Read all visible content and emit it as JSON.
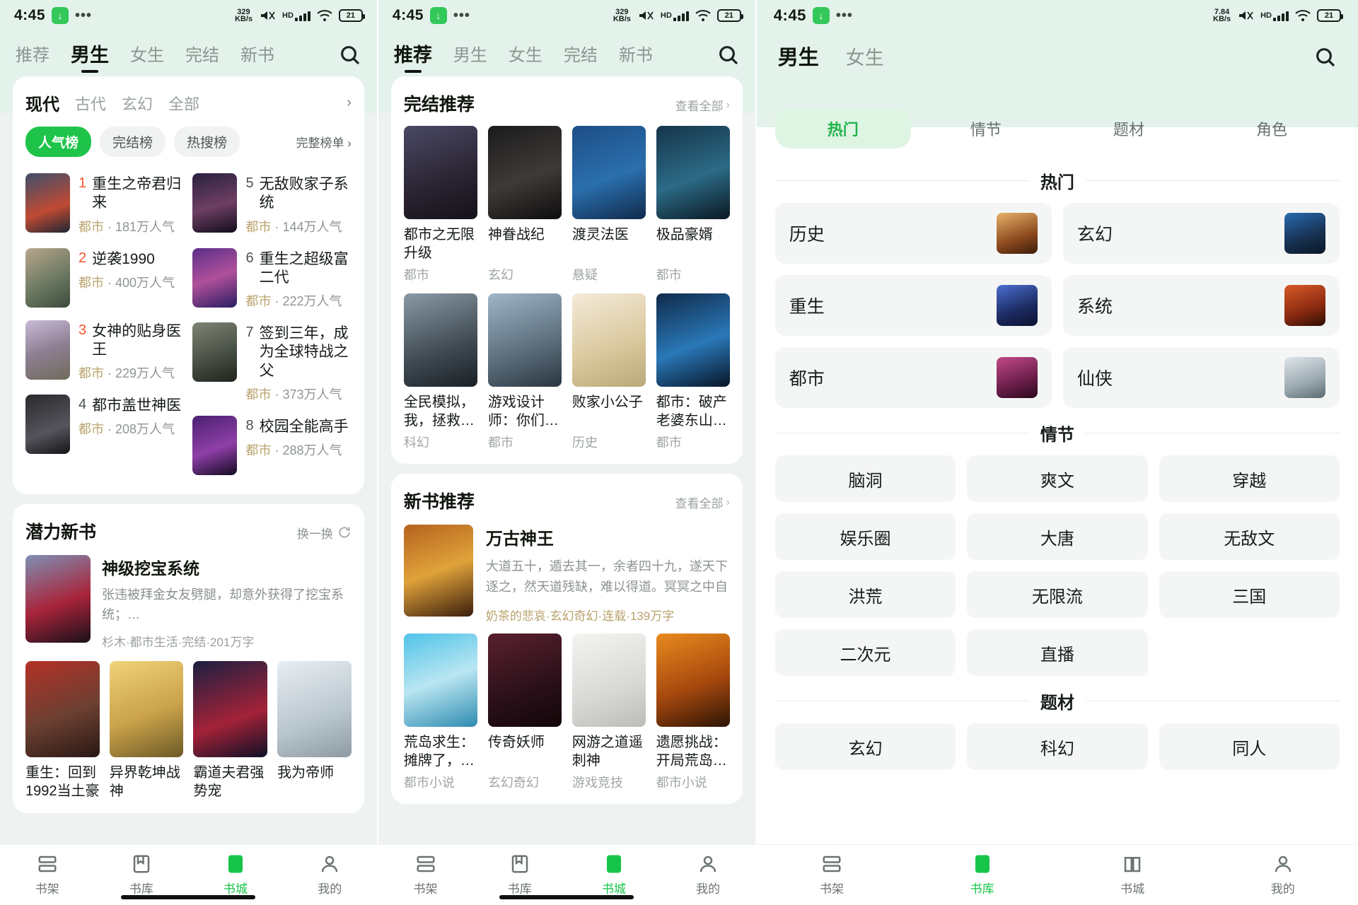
{
  "status_bar": {
    "time": "4:45",
    "download_icon": "download-icon",
    "more_dots": "•••",
    "net_speed_1": "329",
    "net_speed_unit": "KB/s",
    "net_speed_3": "7.84",
    "battery": "21",
    "hd_label": "HD"
  },
  "panel1": {
    "tabs": [
      {
        "label": "推荐",
        "active": false
      },
      {
        "label": "男生",
        "active": true
      },
      {
        "label": "女生",
        "active": false
      },
      {
        "label": "完结",
        "active": false
      },
      {
        "label": "新书",
        "active": false
      }
    ],
    "search_icon": "search-icon",
    "rank_card": {
      "segments": [
        {
          "label": "现代",
          "active": true
        },
        {
          "label": "古代",
          "active": false
        },
        {
          "label": "玄幻",
          "active": false
        },
        {
          "label": "全部",
          "active": false
        }
      ],
      "segment_arrow": "›",
      "pills": [
        {
          "label": "人气榜",
          "active": true
        },
        {
          "label": "完结榜",
          "active": false
        },
        {
          "label": "热搜榜",
          "active": false
        }
      ],
      "full_rank_label": "完整榜单 ›",
      "items_left": [
        {
          "rank": "1",
          "title": "重生之帝君归来",
          "genre": "都市",
          "meta": "181万人气"
        },
        {
          "rank": "2",
          "title": "逆袭1990",
          "genre": "都市",
          "meta": "400万人气"
        },
        {
          "rank": "3",
          "title": "女神的贴身医王",
          "genre": "都市",
          "meta": "229万人气"
        },
        {
          "rank": "4",
          "title": "都市盖世神医",
          "genre": "都市",
          "meta": "208万人气"
        }
      ],
      "items_right": [
        {
          "rank": "5",
          "title": "无敌败家子系统",
          "genre": "都市",
          "meta": "144万人气"
        },
        {
          "rank": "6",
          "title": "重生之超级富二代",
          "genre": "都市",
          "meta": "222万人气"
        },
        {
          "rank": "7",
          "title": "签到三年，成为全球特战之父",
          "genre": "都市",
          "meta": "373万人气"
        },
        {
          "rank": "8",
          "title": "校园全能高手",
          "genre": "都市",
          "meta": "288万人气"
        }
      ]
    },
    "potential_card": {
      "title": "潜力新书",
      "refresh_label": "换一换",
      "refresh_icon": "refresh-icon",
      "featured": {
        "title": "神级挖宝系统",
        "desc": "张违被拜金女友劈腿，却意外获得了挖宝系统；…",
        "meta": "杉木·都市生活·完结·201万字"
      },
      "books": [
        {
          "title": "重生：回到1992当土豪"
        },
        {
          "title": "异界乾坤战神"
        },
        {
          "title": "霸道夫君强势宠"
        },
        {
          "title": "我为帝师"
        }
      ]
    },
    "bottom_nav": [
      {
        "label": "书架",
        "icon": "bookshelf-icon",
        "active": false
      },
      {
        "label": "书库",
        "icon": "library-icon",
        "active": false
      },
      {
        "label": "书城",
        "icon": "bookstore-icon",
        "active": true
      },
      {
        "label": "我的",
        "icon": "profile-icon",
        "active": false
      }
    ]
  },
  "panel2": {
    "tabs": [
      {
        "label": "推荐",
        "active": true
      },
      {
        "label": "男生",
        "active": false
      },
      {
        "label": "女生",
        "active": false
      },
      {
        "label": "完结",
        "active": false
      },
      {
        "label": "新书",
        "active": false
      }
    ],
    "search_icon": "search-icon",
    "finished_card": {
      "title": "完结推荐",
      "more_label": "查看全部",
      "more_icon": "chevron-right-icon",
      "row1": [
        {
          "title": "都市之无限升级",
          "genre": "都市"
        },
        {
          "title": "神眷战纪",
          "genre": "玄幻"
        },
        {
          "title": "渡灵法医",
          "genre": "悬疑"
        },
        {
          "title": "极品豪婿",
          "genre": "都市"
        }
      ],
      "row2": [
        {
          "title": "全民模拟，我，拯救…",
          "genre": "科幻"
        },
        {
          "title": "游戏设计师：你们…",
          "genre": "都市"
        },
        {
          "title": "败家小公子",
          "genre": "历史"
        },
        {
          "title": "都市：破产老婆东山…",
          "genre": "都市"
        }
      ]
    },
    "newbook_card": {
      "title": "新书推荐",
      "more_label": "查看全部",
      "more_icon": "chevron-right-icon",
      "featured": {
        "title": "万古神王",
        "desc": "大道五十，遁去其一，余者四十九，遂天下逐之，然天道残缺，难以得道。冥冥之中自有…",
        "meta": "奶茶的悲哀·玄幻奇幻·连载·139万字"
      },
      "books": [
        {
          "title": "荒岛求生：摊牌了，…",
          "genre": "都市小说"
        },
        {
          "title": "传奇妖师",
          "genre": "玄幻奇幻"
        },
        {
          "title": "网游之道遥刺神",
          "genre": "游戏竞技"
        },
        {
          "title": "遗愿挑战：开局荒岛…",
          "genre": "都市小说"
        }
      ]
    },
    "bottom_nav": [
      {
        "label": "书架",
        "icon": "bookshelf-icon",
        "active": false
      },
      {
        "label": "书库",
        "icon": "library-icon",
        "active": false
      },
      {
        "label": "书城",
        "icon": "bookstore-icon",
        "active": true
      },
      {
        "label": "我的",
        "icon": "profile-icon",
        "active": false
      }
    ]
  },
  "panel3": {
    "tabs": [
      {
        "label": "男生",
        "active": true
      },
      {
        "label": "女生",
        "active": false
      }
    ],
    "search_icon": "search-icon",
    "chips": [
      {
        "label": "热门",
        "active": true
      },
      {
        "label": "情节",
        "active": false
      },
      {
        "label": "题材",
        "active": false
      },
      {
        "label": "角色",
        "active": false
      }
    ],
    "section_hot": {
      "title": "热门",
      "items": [
        {
          "label": "历史",
          "thumb": "cover-history"
        },
        {
          "label": "玄幻",
          "thumb": "cover-xuanhuan"
        },
        {
          "label": "重生",
          "thumb": "cover-rebirth"
        },
        {
          "label": "系统",
          "thumb": "cover-system"
        },
        {
          "label": "都市",
          "thumb": "cover-urban"
        },
        {
          "label": "仙侠",
          "thumb": "cover-xianxia"
        }
      ]
    },
    "section_plot": {
      "title": "情节",
      "items": [
        "脑洞",
        "爽文",
        "穿越",
        "娱乐圈",
        "大唐",
        "无敌文",
        "洪荒",
        "无限流",
        "三国",
        "二次元",
        "直播"
      ]
    },
    "section_theme": {
      "title": "题材",
      "items": [
        "玄幻",
        "科幻",
        "同人"
      ]
    },
    "bottom_nav": [
      {
        "label": "书架",
        "icon": "bookshelf-icon",
        "active": false
      },
      {
        "label": "书库",
        "icon": "library-icon",
        "active": true
      },
      {
        "label": "书城",
        "icon": "bookstore-icon",
        "active": false
      },
      {
        "label": "我的",
        "icon": "profile-icon",
        "active": false
      }
    ]
  },
  "colors": {
    "accent_green": "#1ec44a",
    "chip_green_bg": "#dff5e3",
    "rank_orange": "#f0552b",
    "meta_gold": "#b9a36c"
  }
}
